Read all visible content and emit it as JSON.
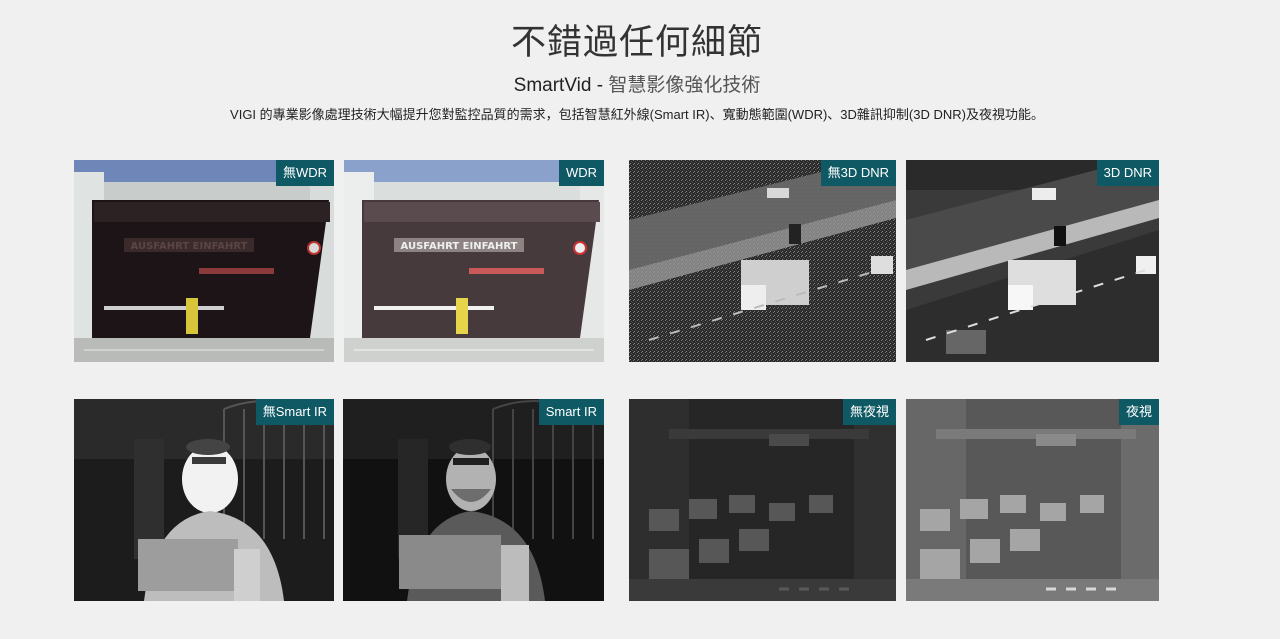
{
  "header": {
    "title": "不錯過任何細節",
    "subtitle_brand": "SmartVid -",
    "subtitle_desc": "智慧影像強化技術",
    "intro": "VIGI 的專業影像處理技術大幅提升您對監控品質的需求，包括智慧紅外線(Smart IR)、寬動態範圍(WDR)、3D雜訊抑制(3D DNR)及夜視功能。"
  },
  "tiles": {
    "wdr_off": {
      "badge": "無WDR",
      "sign_text": "AUSFAHRT EINFAHRT"
    },
    "wdr_on": {
      "badge": "WDR",
      "sign_text": "AUSFAHRT EINFAHRT"
    },
    "dnr_off": {
      "badge": "無3D DNR"
    },
    "dnr_on": {
      "badge": "3D DNR"
    },
    "ir_off": {
      "badge": "無Smart IR"
    },
    "ir_on": {
      "badge": "Smart IR"
    },
    "night_off": {
      "badge": "無夜視"
    },
    "night_on": {
      "badge": "夜視"
    }
  },
  "colors": {
    "badge_bg": "#0f5964",
    "page_bg": "#f0f0f0"
  }
}
